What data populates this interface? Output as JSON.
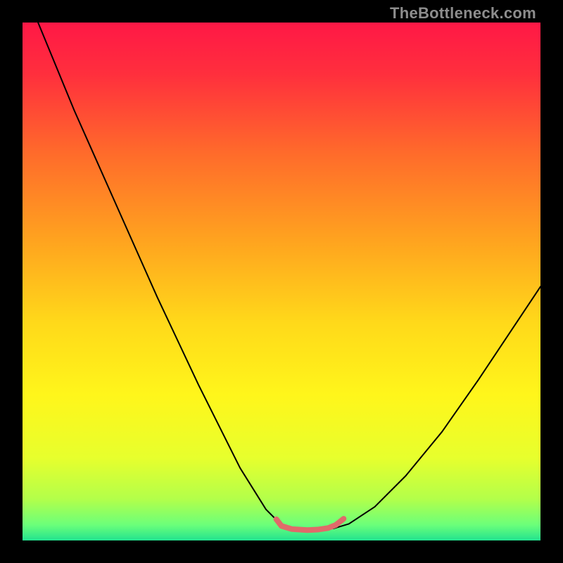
{
  "watermark": "TheBottleneck.com",
  "chart_data": {
    "type": "line",
    "title": "",
    "xlabel": "",
    "ylabel": "",
    "xlim": [
      0,
      100
    ],
    "ylim": [
      0,
      100
    ],
    "grid": false,
    "legend": false,
    "gradient": {
      "stops": [
        {
          "offset": 0.0,
          "color": "#ff1846"
        },
        {
          "offset": 0.1,
          "color": "#ff2f3d"
        },
        {
          "offset": 0.25,
          "color": "#ff6a2b"
        },
        {
          "offset": 0.42,
          "color": "#ffa31f"
        },
        {
          "offset": 0.58,
          "color": "#ffd91a"
        },
        {
          "offset": 0.72,
          "color": "#fff61b"
        },
        {
          "offset": 0.84,
          "color": "#e7ff2d"
        },
        {
          "offset": 0.92,
          "color": "#b3ff4a"
        },
        {
          "offset": 0.97,
          "color": "#6bff7a"
        },
        {
          "offset": 1.0,
          "color": "#22e38f"
        }
      ]
    },
    "series": [
      {
        "name": "left-branch",
        "stroke": "#000000",
        "width": 2.0,
        "x": [
          3.0,
          10.0,
          18.0,
          26.0,
          34.0,
          42.0,
          47.0,
          50.0,
          52.0
        ],
        "y": [
          100.0,
          83.0,
          65.0,
          47.0,
          30.0,
          14.0,
          6.0,
          3.0,
          2.3
        ]
      },
      {
        "name": "right-branch",
        "stroke": "#000000",
        "width": 2.0,
        "x": [
          60.0,
          63.0,
          68.0,
          74.0,
          81.0,
          88.0,
          94.0,
          100.0
        ],
        "y": [
          2.3,
          3.2,
          6.5,
          12.5,
          21.0,
          31.0,
          40.0,
          49.0
        ]
      },
      {
        "name": "valley-floor",
        "stroke": "#e06a6a",
        "width": 8.0,
        "x": [
          49.0,
          50.0,
          52.0,
          55.0,
          57.0,
          59.0,
          60.5,
          62.0
        ],
        "y": [
          4.1,
          2.8,
          2.2,
          2.0,
          2.1,
          2.4,
          3.0,
          4.2
        ]
      }
    ]
  }
}
